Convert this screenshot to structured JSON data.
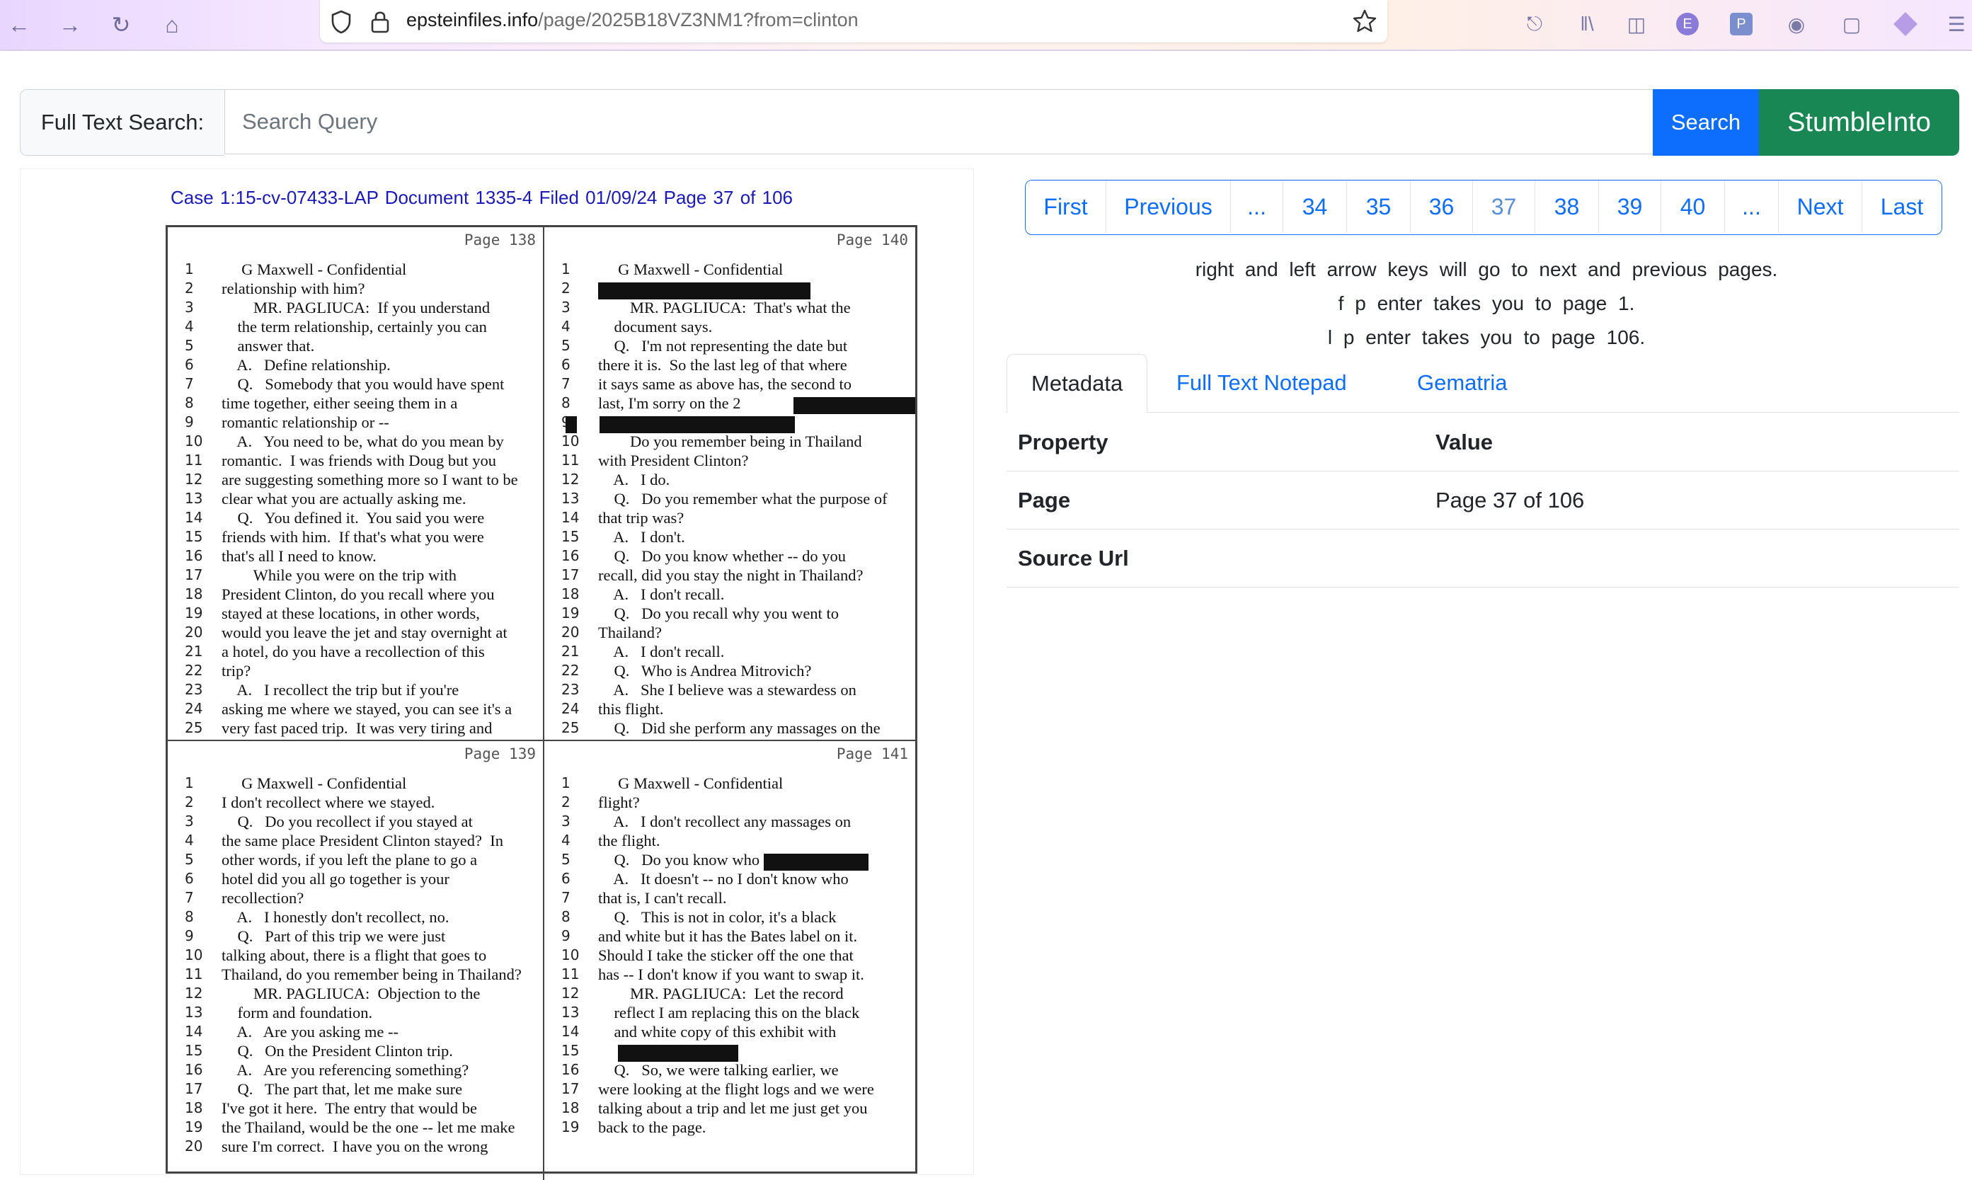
{
  "browser": {
    "url_host": "epsteinfiles.info",
    "url_path": "/page/2025B18VZ3NM1?from=clinton"
  },
  "search": {
    "label": "Full Text Search:",
    "placeholder": "Search Query",
    "button": "Search",
    "stumble": "StumbleInto"
  },
  "doc_header": "Case 1:15-cv-07433-LAP   Document 1335-4   Filed 01/09/24   Page 37 of 106",
  "pages": [
    {
      "page_label": "Page 138",
      "lines": [
        {
          "n": "1",
          "t": "     G Maxwell - Confidential"
        },
        {
          "n": "2",
          "t": "relationship with him?"
        },
        {
          "n": "3",
          "t": "        MR. PAGLIUCA:  If you understand"
        },
        {
          "n": "4",
          "t": "    the term relationship, certainly you can"
        },
        {
          "n": "5",
          "t": "    answer that."
        },
        {
          "n": "6",
          "t": "    A.   Define relationship."
        },
        {
          "n": "7",
          "t": "    Q.   Somebody that you would have spent"
        },
        {
          "n": "8",
          "t": "time together, either seeing them in a"
        },
        {
          "n": "9",
          "t": "romantic relationship or --"
        },
        {
          "n": "10",
          "t": "    A.   You need to be, what do you mean by"
        },
        {
          "n": "11",
          "t": "romantic.  I was friends with Doug but you"
        },
        {
          "n": "12",
          "t": "are suggesting something more so I want to be"
        },
        {
          "n": "13",
          "t": "clear what you are actually asking me."
        },
        {
          "n": "14",
          "t": "    Q.   You defined it.  You said you were"
        },
        {
          "n": "15",
          "t": "friends with him.  If that's what you were"
        },
        {
          "n": "16",
          "t": "that's all I need to know."
        },
        {
          "n": "17",
          "t": "        While you were on the trip with"
        },
        {
          "n": "18",
          "t": "President Clinton, do you recall where you"
        },
        {
          "n": "19",
          "t": "stayed at these locations, in other words,"
        },
        {
          "n": "20",
          "t": "would you leave the jet and stay overnight at"
        },
        {
          "n": "21",
          "t": "a hotel, do you have a recollection of this"
        },
        {
          "n": "22",
          "t": "trip?"
        },
        {
          "n": "23",
          "t": "    A.   I recollect the trip but if you're"
        },
        {
          "n": "24",
          "t": "asking me where we stayed, you can see it's a"
        },
        {
          "n": "25",
          "t": "very fast paced trip.  It was very tiring and"
        }
      ]
    },
    {
      "page_label": "Page 140",
      "lines": [
        {
          "n": "1",
          "t": "     G Maxwell - Confidential"
        },
        {
          "n": "2",
          "t": ""
        },
        {
          "n": "3",
          "t": "        MR. PAGLIUCA:  That's what the"
        },
        {
          "n": "4",
          "t": "    document says."
        },
        {
          "n": "5",
          "t": "    Q.   I'm not representing the date but"
        },
        {
          "n": "6",
          "t": "there it is.  So the last leg of that where"
        },
        {
          "n": "7",
          "t": "it says same as above has, the second to"
        },
        {
          "n": "8",
          "t": "last, I'm sorry on the 2"
        },
        {
          "n": "9",
          "t": ""
        },
        {
          "n": "10",
          "t": "        Do you remember being in Thailand"
        },
        {
          "n": "11",
          "t": "with President Clinton?"
        },
        {
          "n": "12",
          "t": "    A.   I do."
        },
        {
          "n": "13",
          "t": "    Q.   Do you remember what the purpose of"
        },
        {
          "n": "14",
          "t": "that trip was?"
        },
        {
          "n": "15",
          "t": "    A.   I don't."
        },
        {
          "n": "16",
          "t": "    Q.   Do you know whether -- do you"
        },
        {
          "n": "17",
          "t": "recall, did you stay the night in Thailand?"
        },
        {
          "n": "18",
          "t": "    A.   I don't recall."
        },
        {
          "n": "19",
          "t": "    Q.   Do you recall why you went to"
        },
        {
          "n": "20",
          "t": "Thailand?"
        },
        {
          "n": "21",
          "t": "    A.   I don't recall."
        },
        {
          "n": "22",
          "t": "    Q.   Who is Andrea Mitrovich?"
        },
        {
          "n": "23",
          "t": "    A.   She I believe was a stewardess on"
        },
        {
          "n": "24",
          "t": "this flight."
        },
        {
          "n": "25",
          "t": "    Q.   Did she perform any massages on the"
        }
      ]
    },
    {
      "page_label": "Page 139",
      "lines": [
        {
          "n": "1",
          "t": "     G Maxwell - Confidential"
        },
        {
          "n": "2",
          "t": "I don't recollect where we stayed."
        },
        {
          "n": "3",
          "t": "    Q.   Do you recollect if you stayed at"
        },
        {
          "n": "4",
          "t": "the same place President Clinton stayed?  In"
        },
        {
          "n": "5",
          "t": "other words, if you left the plane to go a"
        },
        {
          "n": "6",
          "t": "hotel did you all go together is your"
        },
        {
          "n": "7",
          "t": "recollection?"
        },
        {
          "n": "8",
          "t": "    A.   I honestly don't recollect, no."
        },
        {
          "n": "9",
          "t": "    Q.   Part of this trip we were just"
        },
        {
          "n": "10",
          "t": "talking about, there is a flight that goes to"
        },
        {
          "n": "11",
          "t": "Thailand, do you remember being in Thailand?"
        },
        {
          "n": "12",
          "t": "        MR. PAGLIUCA:  Objection to the"
        },
        {
          "n": "13",
          "t": "    form and foundation."
        },
        {
          "n": "14",
          "t": "    A.   Are you asking me --"
        },
        {
          "n": "15",
          "t": "    Q.   On the President Clinton trip."
        },
        {
          "n": "16",
          "t": "    A.   Are you referencing something?"
        },
        {
          "n": "17",
          "t": "    Q.   The part that, let me make sure"
        },
        {
          "n": "18",
          "t": "I've got it here.  The entry that would be"
        },
        {
          "n": "19",
          "t": "the Thailand, would be the one -- let me make"
        },
        {
          "n": "20",
          "t": "sure I'm correct.  I have you on the wrong"
        }
      ]
    },
    {
      "page_label": "Page 141",
      "lines": [
        {
          "n": "1",
          "t": "     G Maxwell - Confidential"
        },
        {
          "n": "2",
          "t": "flight?"
        },
        {
          "n": "3",
          "t": "    A.   I don't recollect any massages on"
        },
        {
          "n": "4",
          "t": "the flight."
        },
        {
          "n": "5",
          "t": "    Q.   Do you know who"
        },
        {
          "n": "6",
          "t": "    A.   It doesn't -- no I don't know who"
        },
        {
          "n": "7",
          "t": "that is, I can't recall."
        },
        {
          "n": "8",
          "t": "    Q.   This is not in color, it's a black"
        },
        {
          "n": "9",
          "t": "and white but it has the Bates label on it."
        },
        {
          "n": "10",
          "t": "Should I take the sticker off the one that"
        },
        {
          "n": "11",
          "t": "has -- I don't know if you want to swap it."
        },
        {
          "n": "12",
          "t": "        MR. PAGLIUCA:  Let the record"
        },
        {
          "n": "13",
          "t": "    reflect I am replacing this on the black"
        },
        {
          "n": "14",
          "t": "    and white copy of this exhibit with"
        },
        {
          "n": "15",
          "t": ""
        },
        {
          "n": "16",
          "t": "    Q.   So, we were talking earlier, we"
        },
        {
          "n": "17",
          "t": "were looking at the flight logs and we were"
        },
        {
          "n": "18",
          "t": "talking about a trip and let me just get you"
        },
        {
          "n": "19",
          "t": "back to the page."
        }
      ]
    }
  ],
  "pagination": [
    {
      "label": "First",
      "w": 114,
      "active": false
    },
    {
      "label": "Previous",
      "w": 176,
      "active": false
    },
    {
      "label": "...",
      "w": 74,
      "active": false
    },
    {
      "label": "34",
      "w": 90,
      "active": false
    },
    {
      "label": "35",
      "w": 90,
      "active": false
    },
    {
      "label": "36",
      "w": 88,
      "active": false
    },
    {
      "label": "37",
      "w": 88,
      "active": true
    },
    {
      "label": "38",
      "w": 90,
      "active": false
    },
    {
      "label": "39",
      "w": 88,
      "active": false
    },
    {
      "label": "40",
      "w": 90,
      "active": false
    },
    {
      "label": "...",
      "w": 76,
      "active": false
    },
    {
      "label": "Next",
      "w": 118,
      "active": false
    },
    {
      "label": "Last",
      "w": 112,
      "active": false
    }
  ],
  "hints": [
    "right and left arrow keys will go to next and previous pages.",
    "f p enter takes you to page 1.",
    "l p enter takes you to page 106."
  ],
  "tabs": [
    "Metadata",
    "Full Text Notepad",
    "Gematria"
  ],
  "meta_table": {
    "headers": [
      "Property",
      "Value"
    ],
    "rows": [
      {
        "key": "Page",
        "value": "Page 37 of 106"
      },
      {
        "key": "Source Url",
        "value": ""
      }
    ]
  },
  "icons": {
    "back": "arrow-left-icon",
    "forward": "arrow-right-icon",
    "reload": "reload-icon",
    "home": "home-icon",
    "shield": "shield-icon",
    "lock": "lock-icon",
    "star": "bookmark-star-icon"
  },
  "colors": {
    "primary": "#0d6efd",
    "success": "#198754"
  }
}
